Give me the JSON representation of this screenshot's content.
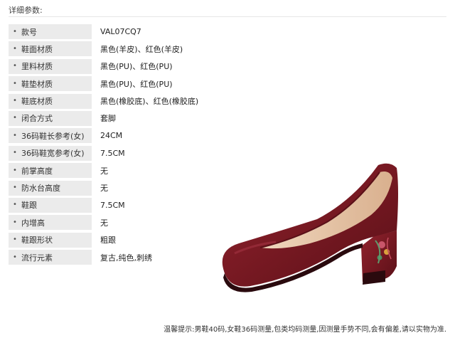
{
  "section_title": "详细参数:",
  "specs": [
    {
      "label": "款号",
      "value": "VAL07CQ7"
    },
    {
      "label": "鞋面材质",
      "value": "黑色(羊皮)、红色(羊皮)"
    },
    {
      "label": "里料材质",
      "value": "黑色(PU)、红色(PU)"
    },
    {
      "label": "鞋垫材质",
      "value": "黑色(PU)、红色(PU)"
    },
    {
      "label": "鞋底材质",
      "value": "黑色(橡胶底)、红色(橡胶底)"
    },
    {
      "label": "闭合方式",
      "value": "套脚"
    },
    {
      "label": "36码鞋长参考(女)",
      "value": "24CM"
    },
    {
      "label": "36码鞋宽参考(女)",
      "value": "7.5CM"
    },
    {
      "label": "前掌高度",
      "value": "无"
    },
    {
      "label": "防水台高度",
      "value": "无"
    },
    {
      "label": "鞋跟",
      "value": "7.5CM"
    },
    {
      "label": "内增高",
      "value": "无"
    },
    {
      "label": "鞋跟形状",
      "value": "粗跟"
    },
    {
      "label": "流行元素",
      "value": "复古,纯色,刺绣"
    }
  ],
  "bullet": "•",
  "footer_note": "温馨提示:男鞋40码,女鞋36码测量,包类均码测量,因测量手势不同,会有偏差,请以实物为准.",
  "colors": {
    "label_bg": "#ebebeb",
    "shoe_suede": "#7a1a24",
    "shoe_lining": "#e8c9ad"
  }
}
